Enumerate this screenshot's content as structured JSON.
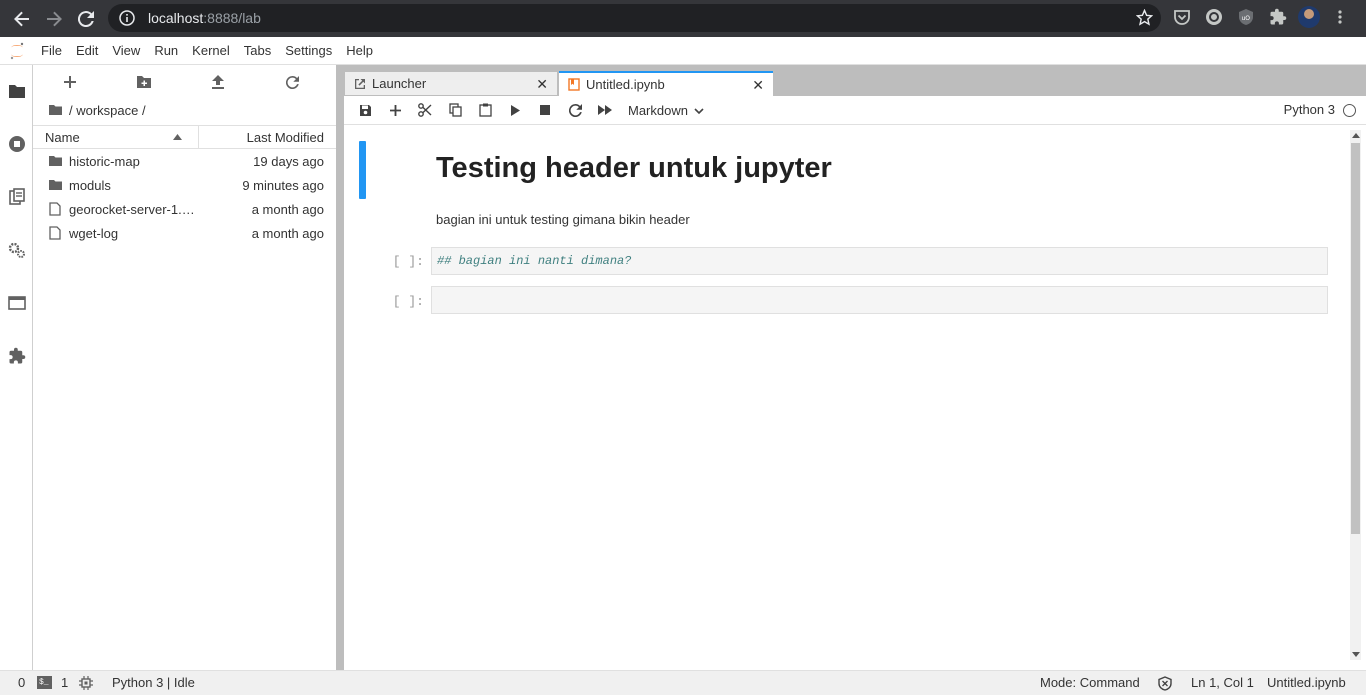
{
  "browser": {
    "url_host": "localhost",
    "url_rest": ":8888/lab"
  },
  "menu": {
    "items": [
      "File",
      "Edit",
      "View",
      "Run",
      "Kernel",
      "Tabs",
      "Settings",
      "Help"
    ]
  },
  "filebrowser": {
    "breadcrumb": "/ workspace /",
    "columns": {
      "name": "Name",
      "modified": "Last Modified"
    },
    "files": [
      {
        "name": "historic-map",
        "modified": "19 days ago",
        "type": "folder"
      },
      {
        "name": "moduls",
        "modified": "9 minutes ago",
        "type": "folder"
      },
      {
        "name": "georocket-server-1.3...",
        "modified": "a month ago",
        "type": "file"
      },
      {
        "name": "wget-log",
        "modified": "a month ago",
        "type": "file"
      }
    ]
  },
  "tabs": {
    "launcher": "Launcher",
    "notebook": "Untitled.ipynb"
  },
  "notebook_toolbar": {
    "cell_type": "Markdown",
    "kernel": "Python 3"
  },
  "notebook": {
    "heading": "Testing header untuk jupyter",
    "paragraph": "bagian ini untuk testing gimana bikin header",
    "cells": [
      {
        "prompt": "[ ]:",
        "source": "## bagian ini nanti dimana?"
      },
      {
        "prompt": "[ ]:",
        "source": ""
      }
    ]
  },
  "statusbar": {
    "count_left": "0",
    "terminals": "1",
    "kernel_status": "Python 3 | Idle",
    "mode": "Mode: Command",
    "position": "Ln 1, Col 1",
    "filename": "Untitled.ipynb"
  },
  "colors": {
    "accent": "#2196f3",
    "browser_bar": "#35363a",
    "code_comment": "#408080"
  }
}
